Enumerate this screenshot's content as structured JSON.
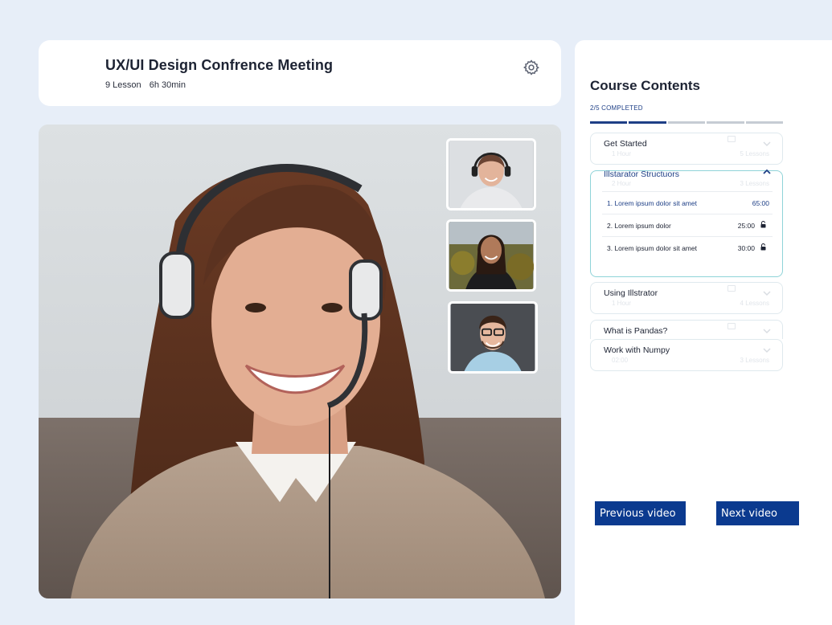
{
  "header": {
    "title": "UX/UI Design Confrence Meeting",
    "lessons": "9 Lesson",
    "duration": "6h 30min"
  },
  "sidebar": {
    "title": "Course Contents",
    "completed_label": "2/5 COMPLETED",
    "progress": {
      "done": 2,
      "total": 5
    },
    "sections": [
      {
        "title": "Get Started",
        "duration": "1 Hour",
        "lessons": "5 Lessons",
        "open": false
      },
      {
        "title": "Illstarator Structuors",
        "duration": "2 Hour",
        "lessons": "3 Lessons",
        "open": true,
        "items": [
          {
            "title": "1. Lorem ipsum dolor sit amet",
            "time": "65:00",
            "locked": false,
            "active": true
          },
          {
            "title": "2. Lorem ipsum dolor",
            "time": "25:00",
            "locked": true,
            "active": false
          },
          {
            "title": "3. Lorem ipsum dolor sit amet",
            "time": "30:00",
            "locked": true,
            "active": false
          }
        ]
      },
      {
        "title": "Using Illstrator",
        "duration": "1 Hour",
        "lessons": "4 Lessons",
        "open": false
      },
      {
        "title": "What is Pandas?",
        "open": false
      },
      {
        "title": "Work with Numpy",
        "duration": "02:00",
        "lessons": "3 Lessons",
        "open": false
      }
    ],
    "prev_label": "Previous video",
    "next_label": "Next video"
  },
  "colors": {
    "accent": "#1e3f86",
    "button": "#0b3a8f",
    "background": "#e7eef8",
    "open_border": "#8fd3d8"
  },
  "icons": {
    "settings": "gear-icon",
    "collapsed": "chevron-down-icon",
    "expanded": "chevron-up-icon",
    "locked": "lock-icon"
  }
}
